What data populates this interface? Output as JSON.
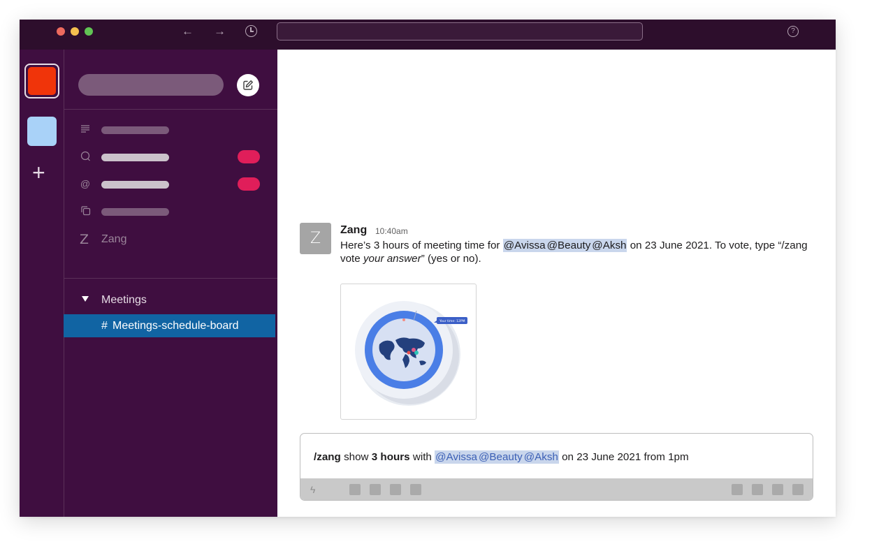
{
  "titlebar": {
    "back_icon": "←",
    "forward_icon": "→",
    "help_icon": "?"
  },
  "rail": {
    "add_icon": "+"
  },
  "sidebar": {
    "app_item_label": "Zang",
    "app_item_icon": "Z",
    "section": {
      "label": "Meetings"
    },
    "channel": {
      "hash": "#",
      "name": "Meetings-schedule-board"
    }
  },
  "message": {
    "avatar_letter": "Z",
    "author": "Zang",
    "time": "10:40am",
    "text_intro": "Here’s 3 hours of meeting time for",
    "mentions": [
      "@Avissa",
      "@Beauty",
      "@Aksh"
    ],
    "text_mid": "on 23 June 2021. To vote, type “/zang vote",
    "text_italic": "your answer",
    "text_end": "” (yes or no).",
    "attachment_label": "Your time: 12PM"
  },
  "composer": {
    "command": "/zang",
    "word_show": "show",
    "duration": "3 hours",
    "word_with": "with",
    "mentions": [
      "@Avissa",
      "@Beauty",
      "@Aksh"
    ],
    "tail": "on 23 June 2021 from 1pm",
    "bolt_icon": "ϟ"
  },
  "colors": {
    "titlebar": "#2d0e2c",
    "sidebar": "#3f0e40",
    "active_channel": "#1164a3",
    "badge": "#e01e5a",
    "workspace_active": "#f0340a",
    "workspace_second": "#a9d2f8",
    "mention_bg": "#c9d6ec"
  }
}
